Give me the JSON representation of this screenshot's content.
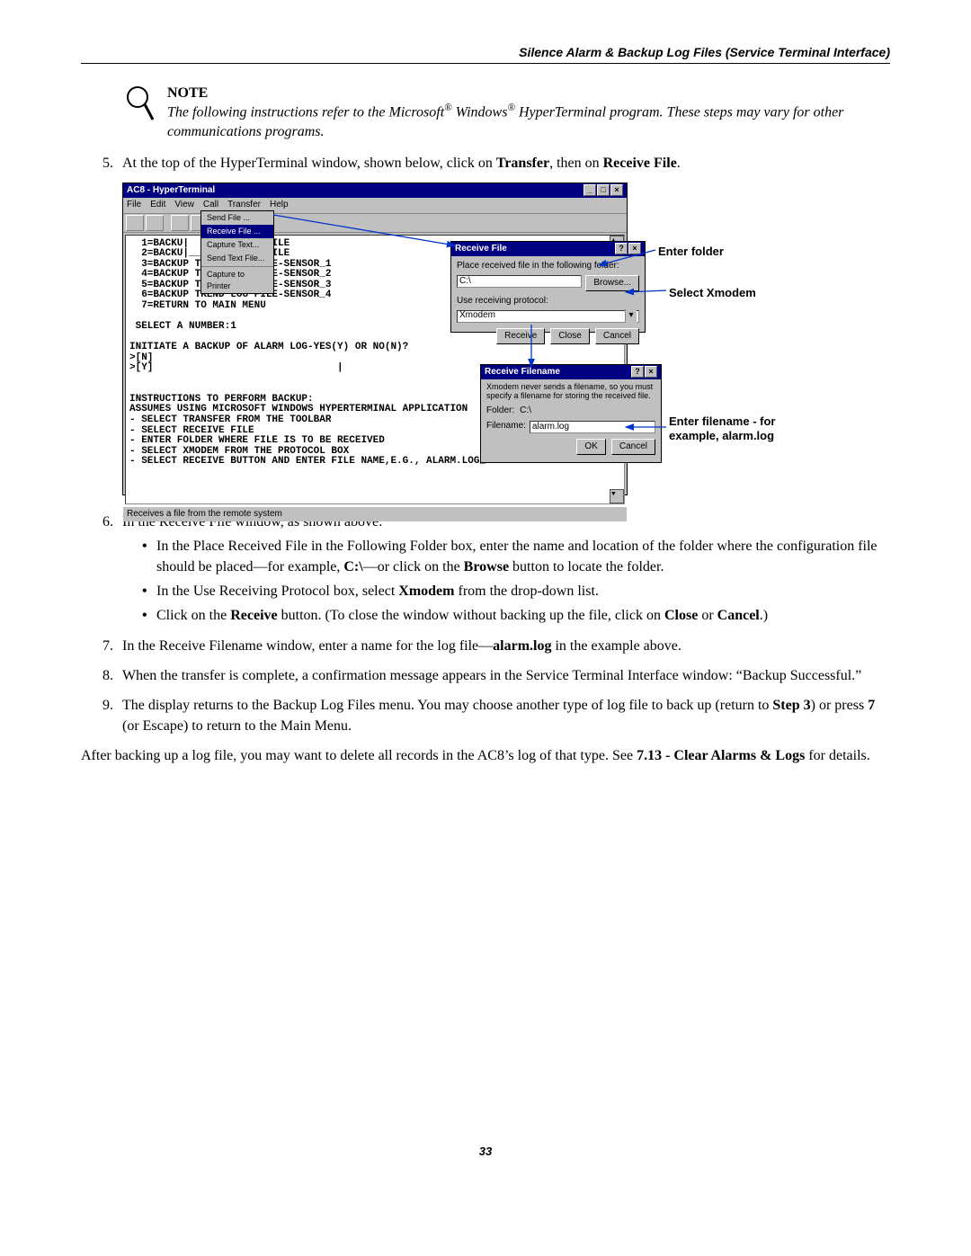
{
  "header": "Silence Alarm & Backup Log Files (Service Terminal Interface)",
  "note": {
    "title": "NOTE",
    "body_pre": "The following instructions refer to the Microsoft",
    "body_mid": " Windows",
    "body_post": " HyperTerminal program. These steps may vary for other communications programs."
  },
  "step5": {
    "pre": "At the top of the HyperTerminal window, shown below, click on ",
    "bold1": "Transfer",
    "mid": ", then on ",
    "bold2": "Receive File",
    "post": "."
  },
  "ht": {
    "title": "AC8 - HyperTerminal",
    "menus": [
      "File",
      "Edit",
      "View",
      "Call",
      "Transfer",
      "Help"
    ],
    "dropdown": {
      "items": [
        "Send File ...",
        "Receive File ...",
        "Capture Text...",
        "Send Text File..."
      ],
      "divider_then": "Capture to Printer"
    },
    "status": "Receives a file from the remote system",
    "terminal_text": "  1=BACKU|             |ILE\n  2=BACKU|_____________|ILE\n  3=BACKUP TREND LOG FILE-SENSOR_1\n  4=BACKUP TREND LOG FILE-SENSOR_2\n  5=BACKUP TREND LOG FILE-SENSOR_3\n  6=BACKUP TREND LOG FILE-SENSOR_4\n  7=RETURN TO MAIN MENU\n\n SELECT A NUMBER:1\n\nINITIATE A BACKUP OF ALARM LOG-YES(Y) OR NO(N)?\n>[N]\n>[Y]                               |\n\n\nINSTRUCTIONS TO PERFORM BACKUP:\nASSUMES USING MICROSOFT WINDOWS HYPERTERMINAL APPLICATION\n- SELECT TRANSFER FROM THE TOOLBAR\n- SELECT RECEIVE FILE\n- ENTER FOLDER WHERE FILE IS TO BE RECEIVED\n- SELECT XMODEM FROM THE PROTOCOL BOX\n- SELECT RECEIVE BUTTON AND ENTER FILE NAME,E.G., ALARM.LOG_"
  },
  "dlg_rf": {
    "title": "Receive File",
    "lbl_folder": "Place received file in the following folder:",
    "folder_value": "C:\\",
    "browse": "Browse...",
    "lbl_protocol": "Use receiving protocol:",
    "protocol_value": "Xmodem",
    "btn_receive": "Receive",
    "btn_close": "Close",
    "btn_cancel": "Cancel"
  },
  "dlg_fn": {
    "title": "Receive Filename",
    "hint": "Xmodem never sends a filename, so you must specify a filename for storing the received file.",
    "lbl_folder": "Folder:",
    "folder_value": "C:\\",
    "lbl_filename": "Filename:",
    "filename_value": "alarm.log",
    "btn_ok": "OK",
    "btn_cancel": "Cancel"
  },
  "callouts": {
    "enter_folder": "Enter folder",
    "select_xmodem": "Select Xmodem",
    "enter_filename": "Enter filename - for example, alarm.log"
  },
  "step6": {
    "intro": "In the Receive File window, as shown above:",
    "bullet1_pre": "In the Place Received File in the Following Folder box, enter the name and location of the folder where the configuration file should be placed—for example, ",
    "bullet1_bold1": "C:\\",
    "bullet1_mid": "—or click on the ",
    "bullet1_bold2": "Browse",
    "bullet1_post": " button to locate the folder.",
    "bullet2_pre": "In the Use Receiving Protocol box, select ",
    "bullet2_bold": "Xmodem",
    "bullet2_post": " from the drop-down list.",
    "bullet3_pre": "Click on the ",
    "bullet3_bold1": "Receive",
    "bullet3_mid": " button. (To close the window without backing up the file, click on ",
    "bullet3_bold2": "Close",
    "bullet3_or": " or ",
    "bullet3_bold3": "Cancel",
    "bullet3_post": ".)"
  },
  "step7": {
    "pre": "In the Receive Filename window, enter a name for the log file—",
    "bold": "alarm.log",
    "post": " in the example above."
  },
  "step8": "When the transfer is complete, a confirmation message appears in the Service Terminal Interface window: “Backup Successful.”",
  "step9": {
    "pre": "The display returns to the Backup Log Files menu. You may choose another type of log file to back up (return to ",
    "bold1": "Step 3",
    "mid": ") or press ",
    "bold2": "7",
    "post": " (or Escape) to return to the Main Menu."
  },
  "after": {
    "pre": "After backing up a log file, you may want to delete all records in the AC8’s log of that type. See ",
    "bold": "7.13 - Clear Alarms & Logs",
    "post": " for details."
  },
  "page_number": "33"
}
